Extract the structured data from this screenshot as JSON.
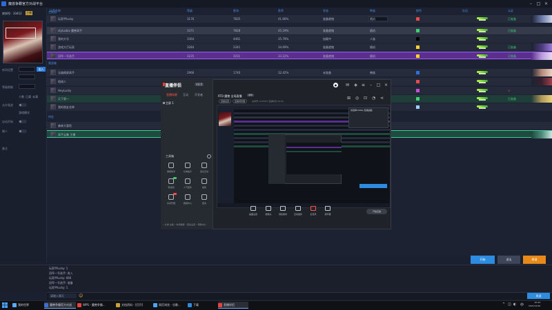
{
  "window": {
    "title": "魔兽争霸官方对战平台",
    "room_line": "房间号：33412",
    "room_tag": "主播"
  },
  "left_panel": {
    "labels": [
      "房间设置",
      "",
      "等级限制",
      "",
      "允许观战",
      "",
      "自动开始",
      "踢人",
      "",
      "备注"
    ],
    "join_label": "加入",
    "option_a": "人数",
    "option_b": "已满",
    "option_c": "未满",
    "mode_text": "游戏模式"
  },
  "list": {
    "headers": [
      "玩家名称",
      "等级",
      "胜场",
      "胜率",
      "状态",
      "种族",
      "颜色",
      "队伍",
      "认证",
      "延迟"
    ],
    "section_top": "主队伍",
    "section_mid": "观战者",
    "section_wait": "待定",
    "rows": [
      {
        "name": "玩家甲lucky",
        "level": "3176",
        "games": "7835",
        "rate": "41.66%",
        "state": "准备就绪",
        "race": "随机",
        "ok": "已准备"
      },
      {
        "name": "stylusbix 魔兽高手",
        "level": "3371",
        "games": "7828",
        "rate": "45.19%",
        "state": "准备就绪",
        "race": "随机",
        "ok": "已准备"
      },
      {
        "name": "我的大号",
        "level": "3364",
        "games": "4461",
        "rate": "35.79%",
        "state": "加载中",
        "race": "人族",
        "ok": ""
      },
      {
        "name": "游戏大厅玩家",
        "level": "3284",
        "games": "2341",
        "rate": "34.69%",
        "state": "准备就绪",
        "race": "随机",
        "ok": "已准备"
      },
      {
        "name": "冠军一号选手",
        "level": "3235",
        "games": "2031",
        "rate": "33.22%",
        "state": "准备就绪",
        "race": "随机",
        "ok": "已准备"
      },
      {
        "name": "无敌刷屏高手",
        "level": "2966",
        "games": "1740",
        "rate": "32.42%",
        "state": "未准备",
        "race": "兽族",
        "ok": ""
      },
      {
        "name": "地球人",
        "level": "3143",
        "games": "1534",
        "rate": "28.63%",
        "state": "准备就绪",
        "race": "随机",
        "ok": ""
      },
      {
        "name": "HeyLucky",
        "level": "3104",
        "games": "1382",
        "rate": "27.51%",
        "state": "准备就绪",
        "race": "随机",
        "ok": ""
      },
      {
        "name": "天下第一",
        "level": "3015",
        "games": "1166",
        "rate": "26.88%",
        "state": "准备就绪",
        "race": "随机",
        "ok": "已准备"
      },
      {
        "name": "我的朋友名称",
        "level": "2875",
        "games": "981",
        "rate": "26.01%",
        "state": "准备就绪",
        "race": "随机",
        "ok": ""
      },
      {
        "name": "森林大冒险",
        "level": "",
        "games": "",
        "rate": "",
        "state": "",
        "race": "",
        "ok": ""
      },
      {
        "name": "高手云集 主播",
        "level": "",
        "games": "",
        "rate": "",
        "state": "",
        "race": "",
        "ok": ""
      }
    ]
  },
  "overlay": {
    "logo": "直播伴侣",
    "version": "V4.0",
    "tabs": [
      "直播场景",
      "互动",
      "开发者"
    ],
    "item": "主屏 1",
    "tools_title": "工具箱",
    "tools": [
      "弹幕助手",
      "礼物提示",
      "连麦互动",
      "粉丝团",
      "人气挂件",
      "抽奖",
      "房间管理",
      "数据中心",
      "更多"
    ],
    "bottom_links": "• 礼物 主播   • 本场数据  • 更多设置  • 帮助中心",
    "live_title": "RTD 魔兽 全场直播",
    "category": "游戏",
    "pills": [
      "直播设置",
      "直播间管理"
    ],
    "meta": "房间号 1234567  直播时长 00:00",
    "notice": "请选择1080p 直播画面",
    "controls": [
      "画面设置",
      "摄像头",
      "添加素材",
      "互动插件",
      "麦克风",
      "扬声器"
    ],
    "start": "开始直播"
  },
  "buttons": {
    "blue": "开始",
    "gray": "退出",
    "orange": "邀请"
  },
  "chat": {
    "lines": [
      "玩家甲lucky: 1",
      "冠军一号选手: 进入",
      "玩家甲lucky: 666",
      "冠军一号选手: 准备",
      "玩家甲lucky: 1"
    ],
    "input": "请输入聊天",
    "send": "发送"
  },
  "taskbar": {
    "items": [
      "我的世界",
      "魔兽争霸官方对战",
      "WPS - 魔兽争霸...",
      "文档资料 - [打开]",
      "网页浏览 - 谷歌...",
      "下载",
      "直播伴侣"
    ],
    "time": "20:42",
    "date": "2021/12/20"
  },
  "colors": {
    "accent": "#2d8be0",
    "orange": "#e88a1a",
    "purple_row": "#5b2f8e",
    "green_row": "#1f4a3e"
  }
}
